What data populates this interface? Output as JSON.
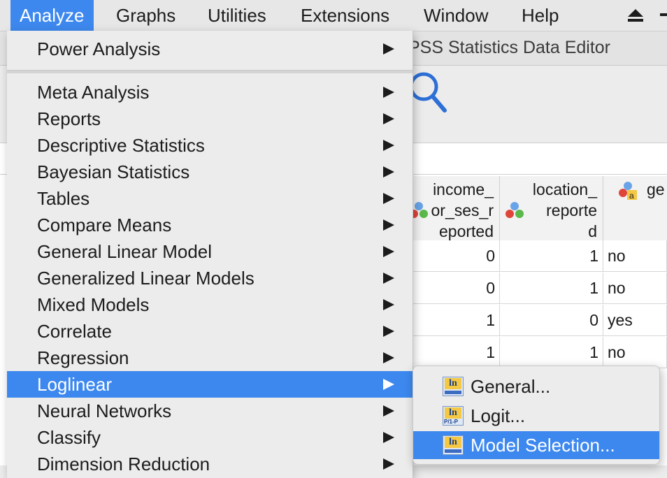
{
  "menubar": {
    "items": [
      "Analyze",
      "Graphs",
      "Utilities",
      "Extensions",
      "Window",
      "Help"
    ],
    "active_index": 0,
    "right_icons": [
      "eject-icon"
    ]
  },
  "window": {
    "title": "PSS Statistics Data Editor",
    "toolbar_icons": [
      "search-icon"
    ]
  },
  "grid": {
    "columns": [
      {
        "header": "income_\nor_ses_r\neported",
        "icon": "scale-variable-icon"
      },
      {
        "header": "location_\nreporte\nd",
        "icon": "nominal-variable-icon"
      },
      {
        "header": "ge",
        "icon": "string-variable-icon"
      }
    ],
    "rows": [
      [
        "0",
        "1",
        "no"
      ],
      [
        "0",
        "1",
        "no"
      ],
      [
        "1",
        "0",
        "yes"
      ],
      [
        "1",
        "1",
        "no"
      ]
    ]
  },
  "dropdown": {
    "items": [
      {
        "label": "Power Analysis",
        "submenu": true
      },
      {
        "label": "Meta Analysis",
        "submenu": true
      },
      {
        "label": "Reports",
        "submenu": true
      },
      {
        "label": "Descriptive Statistics",
        "submenu": true
      },
      {
        "label": "Bayesian Statistics",
        "submenu": true
      },
      {
        "label": "Tables",
        "submenu": true
      },
      {
        "label": "Compare Means",
        "submenu": true
      },
      {
        "label": "General Linear Model",
        "submenu": true
      },
      {
        "label": "Generalized Linear Models",
        "submenu": true
      },
      {
        "label": "Mixed Models",
        "submenu": true
      },
      {
        "label": "Correlate",
        "submenu": true
      },
      {
        "label": "Regression",
        "submenu": true
      },
      {
        "label": "Loglinear",
        "submenu": true
      },
      {
        "label": "Neural Networks",
        "submenu": true
      },
      {
        "label": "Classify",
        "submenu": true
      },
      {
        "label": "Dimension Reduction",
        "submenu": true
      }
    ],
    "highlighted": "Loglinear"
  },
  "submenu": {
    "items": [
      {
        "label": "General...",
        "icon": "loglinear-general-icon"
      },
      {
        "label": "Logit...",
        "icon": "loglinear-logit-icon"
      },
      {
        "label": "Model Selection...",
        "icon": "loglinear-model-selection-icon"
      }
    ],
    "highlighted": "Model Selection..."
  },
  "colors": {
    "menu_highlight": "#3d88ee",
    "menu_bg": "#ececec"
  }
}
